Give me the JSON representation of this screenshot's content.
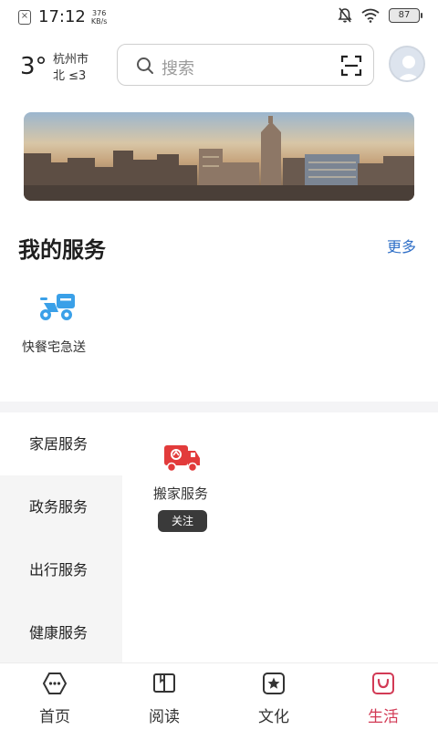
{
  "status_bar": {
    "time": "17:12",
    "speed_value": "376",
    "speed_unit": "KB/s",
    "battery": "87"
  },
  "header": {
    "temperature": "3°",
    "city": "杭州市",
    "wind": "北 ≤3",
    "search_placeholder": "搜索"
  },
  "my_services": {
    "title": "我的服务",
    "more_label": "更多",
    "items": [
      {
        "label": "快餐宅急送",
        "icon": "delivery-scooter-icon"
      }
    ]
  },
  "categories": {
    "items": [
      {
        "label": "家居服务"
      },
      {
        "label": "政务服务"
      },
      {
        "label": "出行服务"
      },
      {
        "label": "健康服务"
      }
    ],
    "active_index": 0,
    "content": {
      "label": "搬家服务",
      "icon": "moving-truck-icon",
      "follow_label": "关注"
    }
  },
  "bottom_nav": {
    "items": [
      {
        "label": "首页",
        "icon": "home-icon"
      },
      {
        "label": "阅读",
        "icon": "book-icon"
      },
      {
        "label": "文化",
        "icon": "star-badge-icon"
      },
      {
        "label": "生活",
        "icon": "shopping-bag-icon"
      }
    ],
    "active_index": 3
  },
  "colors": {
    "accent_blue": "#2f6fc7",
    "active_red": "#d23a55",
    "truck_red": "#e23b3b",
    "scooter_blue": "#3aa0e8"
  }
}
